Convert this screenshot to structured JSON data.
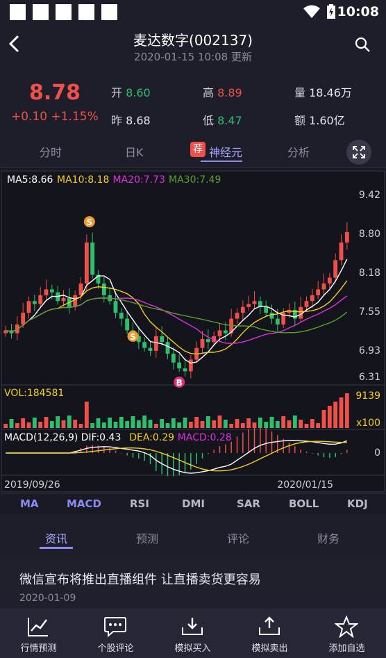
{
  "status_bar": {
    "time": "10:08"
  },
  "header": {
    "title": "麦达数字(002137)",
    "subtitle": "2020-01-15 10:08 更新"
  },
  "quote": {
    "price": "8.78",
    "change": "+0.10 +1.15%",
    "fields": [
      {
        "label": "开",
        "value": "8.60",
        "color": "#2dbf6b"
      },
      {
        "label": "高",
        "value": "8.89",
        "color": "#f0504a"
      },
      {
        "label": "量",
        "value": "18.46万",
        "color": "#e6e6ee"
      },
      {
        "label": "昨",
        "value": "8.68",
        "color": "#e6e6ee"
      },
      {
        "label": "低",
        "value": "8.47",
        "color": "#2dbf6b"
      },
      {
        "label": "额",
        "value": "1.60亿",
        "color": "#e6e6ee"
      }
    ]
  },
  "chart_tabs": [
    "分时",
    "日K",
    "神经元",
    "分析"
  ],
  "chart_tabs_badge": "荐",
  "chart": {
    "ma_legend": [
      {
        "text": "MA5:8.66",
        "color": "#ffffff"
      },
      {
        "text": "MA10:8.18",
        "color": "#f5d018"
      },
      {
        "text": "MA20:7.73",
        "color": "#e030e0"
      },
      {
        "text": "MA30:7.49",
        "color": "#5aa02a"
      }
    ],
    "price_axis": [
      "9.42",
      "8.80",
      "8.18",
      "7.55",
      "6.93",
      "6.31"
    ],
    "vol_label": "VOL:184581",
    "vol_axis": [
      "9139",
      "x100"
    ],
    "macd_legend": [
      {
        "text": "MACD(12,26,9)",
        "color": "#ffffff"
      },
      {
        "text": "DIF:0.43",
        "color": "#ffffff"
      },
      {
        "text": "DEA:0.29",
        "color": "#f5d018"
      },
      {
        "text": "MACD:0.28",
        "color": "#e030e0"
      }
    ],
    "macd_axis": [
      "0"
    ],
    "date_start": "2019/09/26",
    "date_end": "2020/01/15",
    "markers": [
      "S",
      "S",
      "B"
    ]
  },
  "indicator_tabs": [
    "MA",
    "MACD",
    "RSI",
    "DMI",
    "SAR",
    "BOLL",
    "KDJ"
  ],
  "news_tabs": [
    "资讯",
    "预测",
    "评论",
    "财务"
  ],
  "news": {
    "title": "微信宣布将推出直播组件 让直播卖货更容易",
    "date": "2020-01-09"
  },
  "bottom_nav": [
    "行情预测",
    "个股评论",
    "模拟买入",
    "模拟卖出",
    "添加自选"
  ],
  "colors": {
    "up": "#f0504a",
    "down": "#2dbf6b",
    "accent": "#8b8bf0"
  },
  "chart_data": {
    "type": "candlestick",
    "x_range": [
      "2019/09/26",
      "2020/01/15"
    ],
    "ylim": [
      6.31,
      9.42
    ],
    "close_shape": [
      7.1,
      7.05,
      7.2,
      7.4,
      7.6,
      7.55,
      7.7,
      7.8,
      7.75,
      7.6,
      7.65,
      7.5,
      7.7,
      7.9,
      8.6,
      8.05,
      7.9,
      7.7,
      7.6,
      7.4,
      7.3,
      7.1,
      7.0,
      6.9,
      6.8,
      6.75,
      7.0,
      6.9,
      6.7,
      6.55,
      6.45,
      6.4,
      6.6,
      6.8,
      6.95,
      6.9,
      7.0,
      7.1,
      7.05,
      7.3,
      7.4,
      7.5,
      7.55,
      7.6,
      7.5,
      7.4,
      7.3,
      7.2,
      7.4,
      7.45,
      7.3,
      7.5,
      7.6,
      7.7,
      7.8,
      7.9,
      8.0,
      8.3,
      8.6,
      8.78
    ]
  }
}
